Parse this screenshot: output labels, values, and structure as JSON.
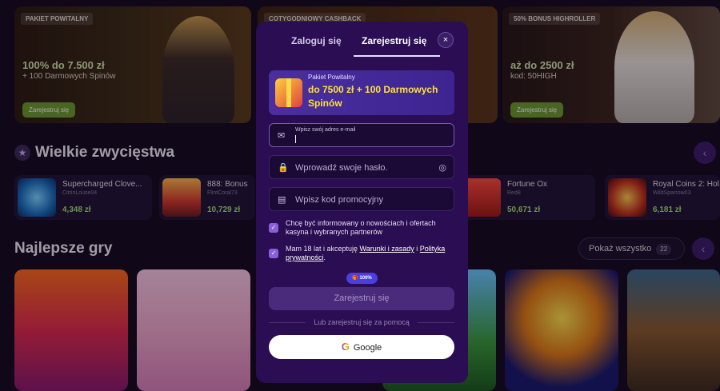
{
  "promos": [
    {
      "tag": "PAKIET POWITALNY",
      "headline": "100% do 7.500 zł",
      "sub": "+ 100 Darmowych Spinów",
      "button": "Zarejestruj się"
    },
    {
      "tag": "COTYGODNIOWY CASHBACK"
    },
    {
      "tag": "50% BONUS HIGHROLLER",
      "headline": "aż do 2500 zł",
      "sub": "kod: 50HIGH",
      "button": "Zarejestruj się"
    }
  ],
  "big_wins": {
    "title": "Wielkie zwycięstwa",
    "items": [
      {
        "name": "Supercharged Clove...",
        "user": "CitrinLouse04",
        "amount": "4,348 zł"
      },
      {
        "name": "888: Bonus",
        "user": "FlintCoral73",
        "amount": "10,729 zł"
      },
      {
        "name": "Fortune Ox",
        "user": "Red8",
        "amount": "50,671 zł"
      },
      {
        "name": "Royal Coins 2: Hol",
        "user": "WildSparrow03",
        "amount": "6,181 zł"
      }
    ]
  },
  "best_games": {
    "title": "Najlepsze gry",
    "show_all": "Pokaż wszystko",
    "count": "22"
  },
  "modal": {
    "tab_login": "Zaloguj się",
    "tab_register": "Zarejestruj się",
    "close": "×",
    "bonus_small": "Pakiet Powitalny",
    "bonus_main": "do 7500 zł + 100 Darmowych Spinów",
    "email_label": "Wpisz swój adres e-mail",
    "password_placeholder": "Wprowadź swoje hasło.",
    "promo_placeholder": "Wpisz kod promocyjny",
    "consent_marketing": "Chcę być informowany o nowościach i ofertach kasyna i wybranych partnerów",
    "consent_age_prefix": "Mam 18 lat i akceptuję ",
    "terms": "Warunki i zasady",
    "consent_and": " i ",
    "privacy": "Polityka prywatności",
    "consent_end": ".",
    "badge": "100%",
    "register_button": "Zarejestruj się",
    "or_text": "Lub zarejestruj się za pomocą",
    "google": "Google",
    "google_letter": "G"
  },
  "colors": {
    "modal_bg": "#2a0d52",
    "accent": "#8a5fd8",
    "win_amount": "#9be36a",
    "bonus_text": "#ffe03a"
  }
}
